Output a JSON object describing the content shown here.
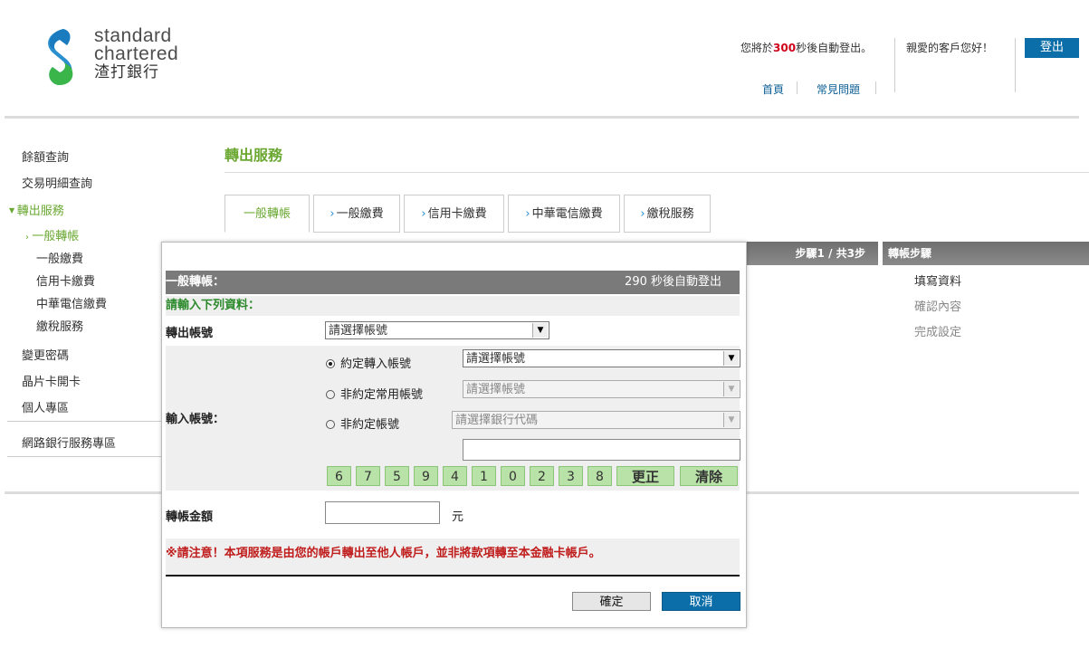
{
  "brand": {
    "line1": "standard",
    "line2": "chartered",
    "line3": "渣打銀行"
  },
  "header": {
    "timer_prefix": "您將於",
    "timer_seconds": "300",
    "timer_suffix": "秒後自動登出。",
    "greeting": "親愛的客戶您好！",
    "logout": "登出",
    "links": [
      "首頁",
      "常見問題"
    ]
  },
  "sidebar": {
    "items": [
      {
        "label": "餘額查詢"
      },
      {
        "label": "交易明細查詢"
      },
      {
        "label": "轉出服務"
      }
    ],
    "subitems": [
      {
        "label": "一般轉帳"
      },
      {
        "label": "一般繳費"
      },
      {
        "label": "信用卡繳費"
      },
      {
        "label": "中華電信繳費"
      },
      {
        "label": "繳稅服務"
      }
    ],
    "items2": [
      {
        "label": "變更密碼"
      },
      {
        "label": "晶片卡開卡"
      },
      {
        "label": "個人專區"
      },
      {
        "label": "網路銀行服務專區"
      }
    ]
  },
  "page": {
    "title": "轉出服務",
    "tabs": [
      {
        "label": "一般轉帳"
      },
      {
        "label": "一般繳費"
      },
      {
        "label": "信用卡繳費"
      },
      {
        "label": "中華電信繳費"
      },
      {
        "label": "繳稅服務"
      }
    ],
    "step_indicator": "步驟1 / 共3步",
    "steps_header": "轉帳步驟",
    "steps": [
      "填寫資料",
      "確認內容",
      "完成設定"
    ]
  },
  "modal": {
    "title": "一般轉帳：",
    "countdown": "290 秒後自動登出",
    "instruction": "請輸入下列資料：",
    "from_label": "轉出帳號",
    "from_value": "請選擇帳號",
    "to_label": "輸入帳號：",
    "options": [
      {
        "label": "約定轉入帳號",
        "value": "請選擇帳號"
      },
      {
        "label": "非約定常用帳號",
        "value": "請選擇帳號"
      },
      {
        "label": "非約定帳號",
        "value": "請選擇銀行代碼"
      }
    ],
    "keypad": [
      "6",
      "7",
      "5",
      "9",
      "4",
      "1",
      "0",
      "2",
      "3",
      "8"
    ],
    "correct": "更正",
    "clear": "清除",
    "amount_label": "轉帳金額",
    "currency": "元",
    "notice": "※請注意！本項服務是由您的帳戶轉出至他人帳戶，並非將款項轉至本金融卡帳戶。",
    "confirm": "確定",
    "cancel": "取消"
  }
}
